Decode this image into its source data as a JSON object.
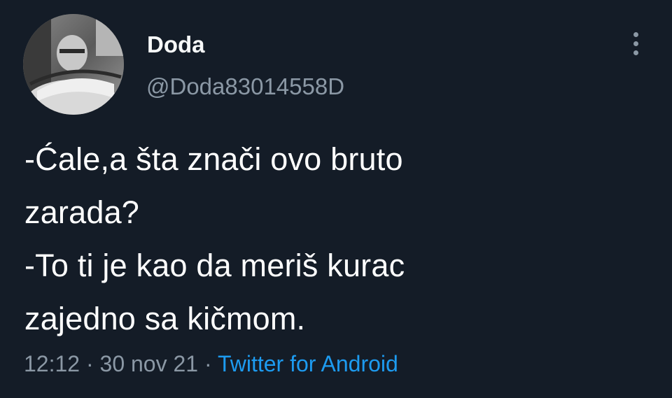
{
  "author": {
    "display_name": "Doda",
    "handle": "@Doda83014558D"
  },
  "tweet": {
    "lines": [
      "-Ćale,a šta znači ovo bruto",
      "zarada?",
      "-To ti je kao da meriš kurac",
      "zajedno sa kičmom."
    ]
  },
  "meta": {
    "time": "12:12",
    "separator_1": " · ",
    "date": "30 nov 21",
    "separator_2": " · ",
    "source": "Twitter for Android"
  },
  "icons": {
    "more": "more-vertical-icon"
  },
  "colors": {
    "background": "#141c27",
    "text": "#ffffff",
    "secondary": "#8b98a5",
    "link": "#1d9bf0"
  }
}
